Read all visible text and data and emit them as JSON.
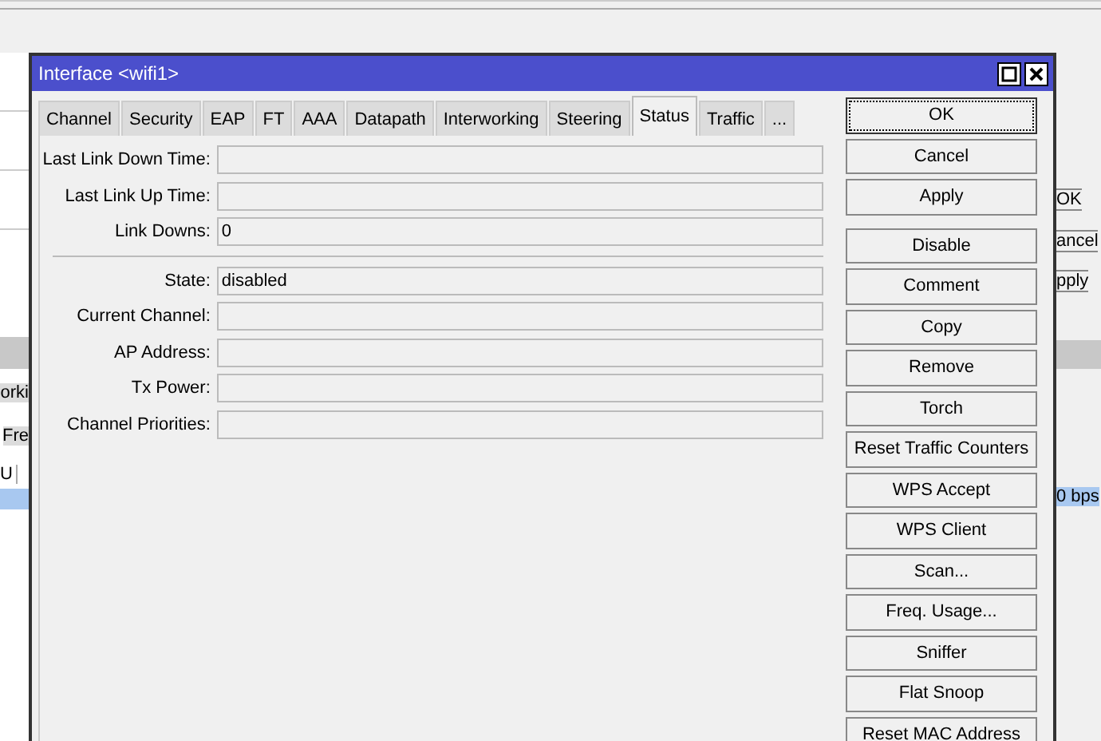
{
  "background_window": {
    "left_texts": [
      {
        "text": "orki",
        "kind": "tab"
      },
      {
        "text": "Fre",
        "kind": "tab"
      },
      {
        "text": "U",
        "kind": "header"
      }
    ],
    "right_texts": [
      {
        "text": "OK",
        "kind": "button"
      },
      {
        "text": "ancel",
        "kind": "button"
      },
      {
        "text": "pply",
        "kind": "button"
      },
      {
        "text": "0 bps",
        "kind": "cell"
      }
    ]
  },
  "window": {
    "title": "Interface <wifi1>"
  },
  "tabs": [
    {
      "label": "Channel",
      "selected": false
    },
    {
      "label": "Security",
      "selected": false
    },
    {
      "label": "EAP",
      "selected": false
    },
    {
      "label": "FT",
      "selected": false
    },
    {
      "label": "AAA",
      "selected": false
    },
    {
      "label": "Datapath",
      "selected": false
    },
    {
      "label": "Interworking",
      "selected": false
    },
    {
      "label": "Steering",
      "selected": false
    },
    {
      "label": "Status",
      "selected": true
    },
    {
      "label": "Traffic",
      "selected": false
    },
    {
      "label": "...",
      "selected": false
    }
  ],
  "field_groups": [
    [
      {
        "label": "Last Link Down Time:"
      },
      {
        "label": "Last Link Up Time:"
      },
      {
        "label": "Link Downs:",
        "value": "0"
      }
    ],
    [
      {
        "label": "State:",
        "value": "disabled"
      },
      {
        "label": "Current Channel:"
      },
      {
        "label": "AP Address:"
      },
      {
        "label": "Tx Power:"
      },
      {
        "label": "Channel Priorities:"
      }
    ]
  ],
  "button_groups": [
    [
      {
        "label": "OK",
        "focused": true
      },
      {
        "label": "Cancel",
        "focused": false
      },
      {
        "label": "Apply",
        "focused": false
      }
    ],
    [
      {
        "label": "Disable",
        "focused": false
      },
      {
        "label": "Comment",
        "focused": false
      },
      {
        "label": "Copy",
        "focused": false
      },
      {
        "label": "Remove",
        "focused": false
      },
      {
        "label": "Torch",
        "focused": false
      },
      {
        "label": "Reset Traffic Counters",
        "focused": false
      },
      {
        "label": "WPS Accept",
        "focused": false
      },
      {
        "label": "WPS Client",
        "focused": false
      },
      {
        "label": "Scan...",
        "focused": false
      },
      {
        "label": "Freq. Usage...",
        "focused": false
      },
      {
        "label": "Sniffer",
        "focused": false
      },
      {
        "label": "Flat Snoop",
        "focused": false
      },
      {
        "label": "Reset MAC Address",
        "focused": false
      }
    ]
  ]
}
